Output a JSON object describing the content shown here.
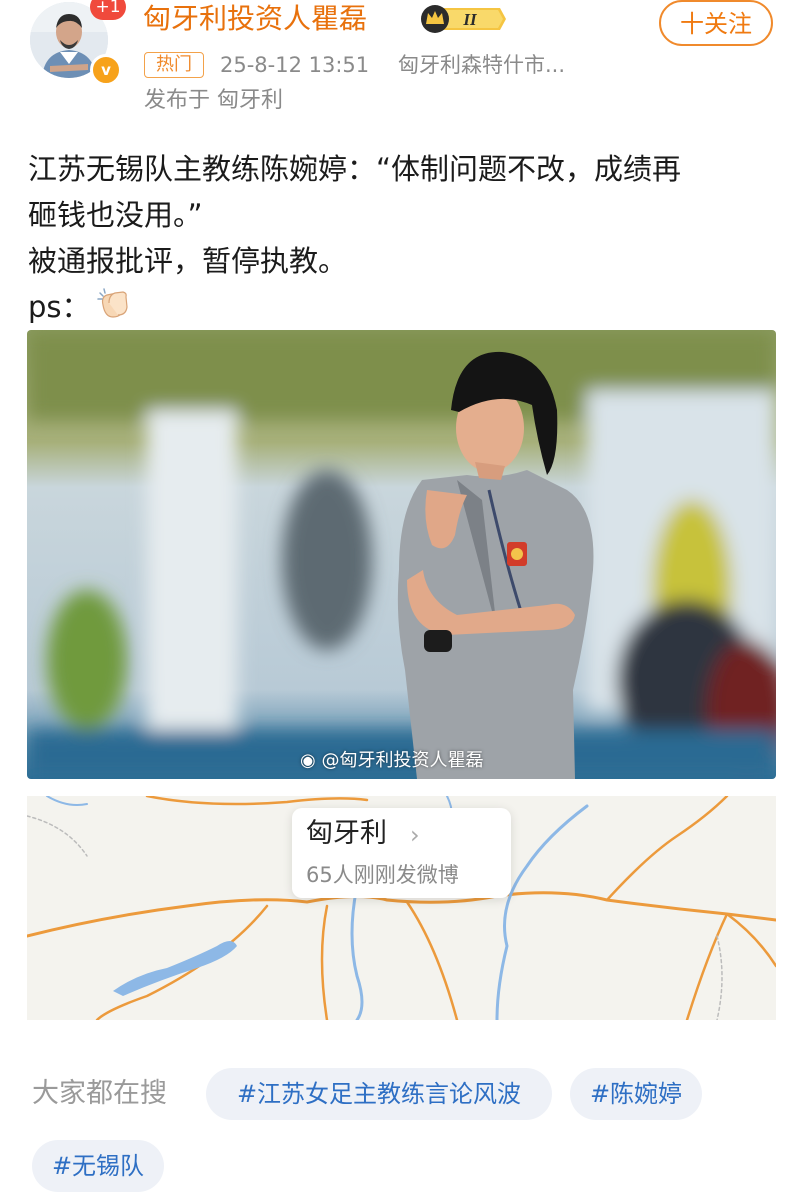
{
  "header": {
    "username": "匈牙利投资人瞿磊",
    "level_badge": "II",
    "notification_badge": "+1",
    "follow_button": "十关注",
    "hot_tag": "热门",
    "timestamp": "25-8-12 13:51",
    "location": "匈牙利森特什市...",
    "published_in": "发布于 匈牙利",
    "verified_color": "#f7a21b",
    "accent_color": "#e8710c"
  },
  "post": {
    "lines": [
      "江苏无锡队主教练陈婉婷：“体制问题不改，成绩再",
      "砸钱也没用。”",
      "被通报批评，暂停执教。"
    ],
    "ps_label": "ps：",
    "ps_emoji_icon": "clapping-hands-icon"
  },
  "photo": {
    "watermark": "@匈牙利投资人瞿磊"
  },
  "map": {
    "place_name": "匈牙利",
    "chevron": "›",
    "post_count": "65人刚刚发微博"
  },
  "hot_search": {
    "label": "大家都在搜",
    "tags": [
      "#江苏女足主教练言论风波",
      "#陈婉婷",
      "#无锡队"
    ]
  }
}
